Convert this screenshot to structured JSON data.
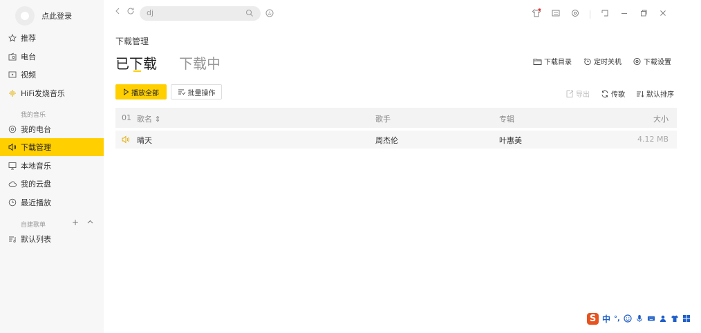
{
  "sidebar": {
    "login_label": "点此登录",
    "items_main": [
      {
        "label": "推荐",
        "icon": "star-icon"
      },
      {
        "label": "电台",
        "icon": "radio-icon"
      },
      {
        "label": "视频",
        "icon": "video-icon"
      },
      {
        "label": "HiFi发烧音乐",
        "icon": "hifi-icon"
      }
    ],
    "section_my_music": "我的音乐",
    "items_my": [
      {
        "label": "我的电台",
        "icon": "my-radio-icon"
      },
      {
        "label": "下载管理",
        "icon": "download-icon",
        "active": true
      },
      {
        "label": "本地音乐",
        "icon": "monitor-icon"
      },
      {
        "label": "我的云盘",
        "icon": "cloud-icon"
      },
      {
        "label": "最近播放",
        "icon": "clock-icon"
      }
    ],
    "section_playlists": "自建歌单",
    "section_add": "+",
    "section_collapse": "^",
    "playlists": [
      {
        "label": "默认列表",
        "icon": "playlist-icon"
      }
    ]
  },
  "search": {
    "value": "dj"
  },
  "main": {
    "page_title": "下载管理",
    "tabs": [
      {
        "label": "已下载",
        "active": true
      },
      {
        "label": "下载中",
        "active": false
      }
    ],
    "top_actions": [
      {
        "label": "下载目录",
        "icon": "folder-icon"
      },
      {
        "label": "定时关机",
        "icon": "timer-icon"
      },
      {
        "label": "下载设置",
        "icon": "settings-icon"
      }
    ],
    "play_all_label": "播放全部",
    "batch_label": "批量操作",
    "list_actions": [
      {
        "label": "导出",
        "icon": "export-icon",
        "disabled": true
      },
      {
        "label": "传歌",
        "icon": "transfer-icon",
        "disabled": false
      },
      {
        "label": "默认排序",
        "icon": "sort-icon",
        "disabled": false
      }
    ],
    "table": {
      "head_num": "01",
      "columns": {
        "name": "歌名 ⇕",
        "artist": "歌手",
        "album": "专辑",
        "size": "大小"
      },
      "rows": [
        {
          "name": "晴天",
          "artist": "周杰伦",
          "album": "叶惠美",
          "size": "4.12 MB"
        }
      ]
    }
  },
  "ime": {
    "logo": "S",
    "lang": "中",
    "punct": "°,"
  },
  "colors": {
    "accent": "#ffcf00",
    "sidebar_bg": "#f7f7f7",
    "ime_logo": "#e8521f"
  }
}
